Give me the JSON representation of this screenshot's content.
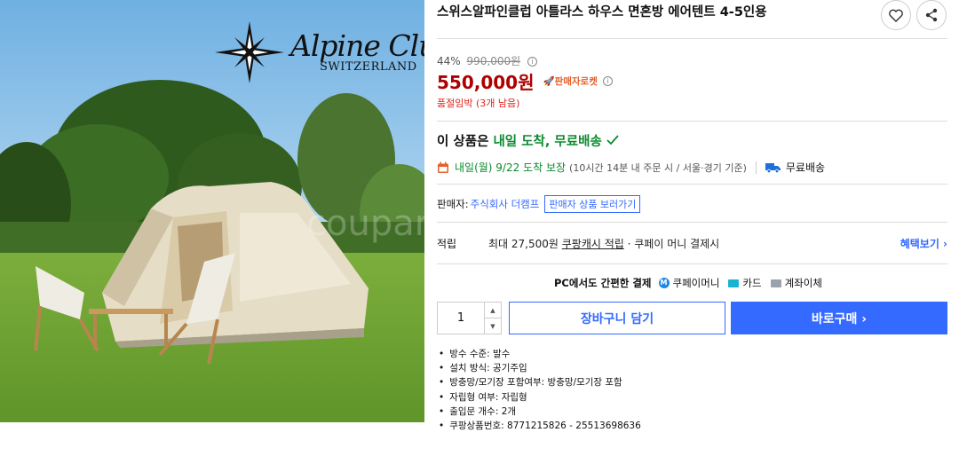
{
  "image": {
    "brand_name": "Alpine Club",
    "brand_sub": "SWITZERLAND",
    "watermark": "coupang"
  },
  "product": {
    "title": "스위스알파인클럽 아틀라스 하우스 면혼방 에어텐트 4-5인용",
    "discount_rate": "44%",
    "original_price": "990,000원",
    "price": "550,000원",
    "badge": "🚀판매자로켓",
    "stock_warning": "품절임박 (3개 남음)",
    "arrival_prefix": "이 상품은 ",
    "arrival_highlight": "내일 도착, 무료배송",
    "delivery_date": "내일(월) 9/22 도착 보장",
    "delivery_condition": "(10시간 14분 내 주문 시 / 서울·경기 기준)",
    "free_shipping": "무료배송",
    "seller_label": "판매자:",
    "seller_name": "주식회사 더캠프",
    "seller_more": "판매자 상품 보러가기",
    "reward_label": "적립",
    "reward_text_pre": "최대 27,500원 ",
    "reward_text_link": "쿠팡캐시 적립",
    "reward_text_post": " · 쿠페이 머니 결제시",
    "reward_benefit": "혜택보기 ›",
    "pay_title": "PC에서도 간편한 결제",
    "pay_options": [
      "쿠페이머니",
      "카드",
      "계좌이체"
    ],
    "quantity": "1",
    "cart_button": "장바구니 담기",
    "buy_button": "바로구매 ›",
    "attributes": [
      "방수 수준: 발수",
      "설치 방식: 공기주입",
      "방충망/모기장 포함여부: 방충망/모기장 포함",
      "자립형 여부: 자립형",
      "출입문 개수: 2개",
      "쿠팡상품번호: 8771215826 - 25513698636"
    ]
  },
  "colors": {
    "accent": "#346aff",
    "price": "#ae0000",
    "delivery": "#0a8a2e",
    "stock": "#e0231b"
  },
  "icons": [
    "heart-icon",
    "share-icon",
    "info-icon",
    "calendar-icon",
    "truck-icon",
    "check-icon"
  ]
}
